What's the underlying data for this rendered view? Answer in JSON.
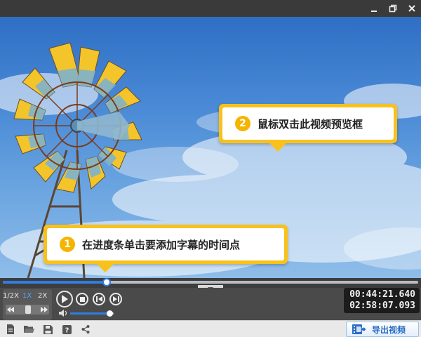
{
  "window": {
    "controls": [
      {
        "name": "minimize-icon"
      },
      {
        "name": "restore-icon"
      },
      {
        "name": "close-icon"
      }
    ]
  },
  "preview": {
    "scene": "windmill-sky"
  },
  "callouts": [
    {
      "number": "2",
      "text": "鼠标双击此视频预览框"
    },
    {
      "number": "1",
      "text": "在进度条单击要添加字幕的时间点"
    }
  ],
  "progress": {
    "played_fraction": 0.25,
    "collapse_icon": "chevron-down-icon"
  },
  "speed": {
    "options": [
      "1/2X",
      "1X",
      "2X"
    ],
    "selected": "1X"
  },
  "playback": {
    "buttons": [
      {
        "name": "play-button",
        "icon": "play-icon"
      },
      {
        "name": "stop-button",
        "icon": "stop-icon"
      },
      {
        "name": "prev-frame-button",
        "icon": "prev-frame-icon"
      },
      {
        "name": "next-frame-button",
        "icon": "next-frame-icon"
      }
    ],
    "volume_fraction": 0.9
  },
  "time": {
    "current": "00:44:21.640",
    "total": "02:58:07.093"
  },
  "toolbar": {
    "tools": [
      "new-file-icon",
      "open-folder-icon",
      "save-icon",
      "help-icon",
      "share-icon"
    ],
    "export_label": "导出视频",
    "export_icon": "film-export-icon"
  },
  "colors": {
    "accent_blue": "#2f7de1",
    "callout_yellow": "#f8c21b",
    "speed_active": "#4fa3ff"
  }
}
